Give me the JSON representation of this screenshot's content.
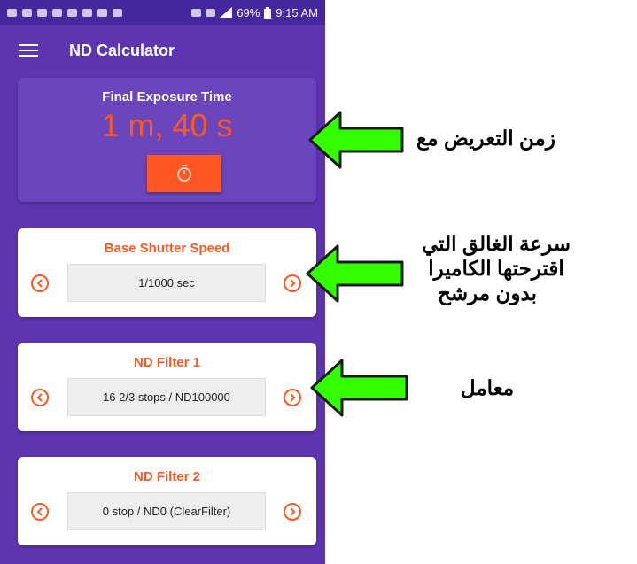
{
  "status_bar": {
    "battery": "69%",
    "time": "9:15 AM"
  },
  "toolbar": {
    "title": "ND Calculator"
  },
  "final_exposure": {
    "title": "Final Exposure Time",
    "value": "1 m, 40 s"
  },
  "base_shutter": {
    "title": "Base Shutter Speed",
    "value": "1/1000 sec"
  },
  "nd_filter_1": {
    "title": "ND Filter 1",
    "value": "16 2/3 stops  / ND100000"
  },
  "nd_filter_2": {
    "title": "ND Filter 2",
    "value": "0 stop  / ND0 (ClearFilter)"
  },
  "annotations": {
    "exposure_note": "زمن التعريض مع",
    "shutter_note_line1": "سرعة الغالق التي",
    "shutter_note_line2": "اقترحتها الكاميرا",
    "shutter_note_line3": "بدون مرشح",
    "factor_note": "معامل"
  },
  "colors": {
    "primary": "#5e35b1",
    "primary_dark": "#4527a0",
    "accent": "#ff5722",
    "arrow_green": "#33ff00"
  }
}
